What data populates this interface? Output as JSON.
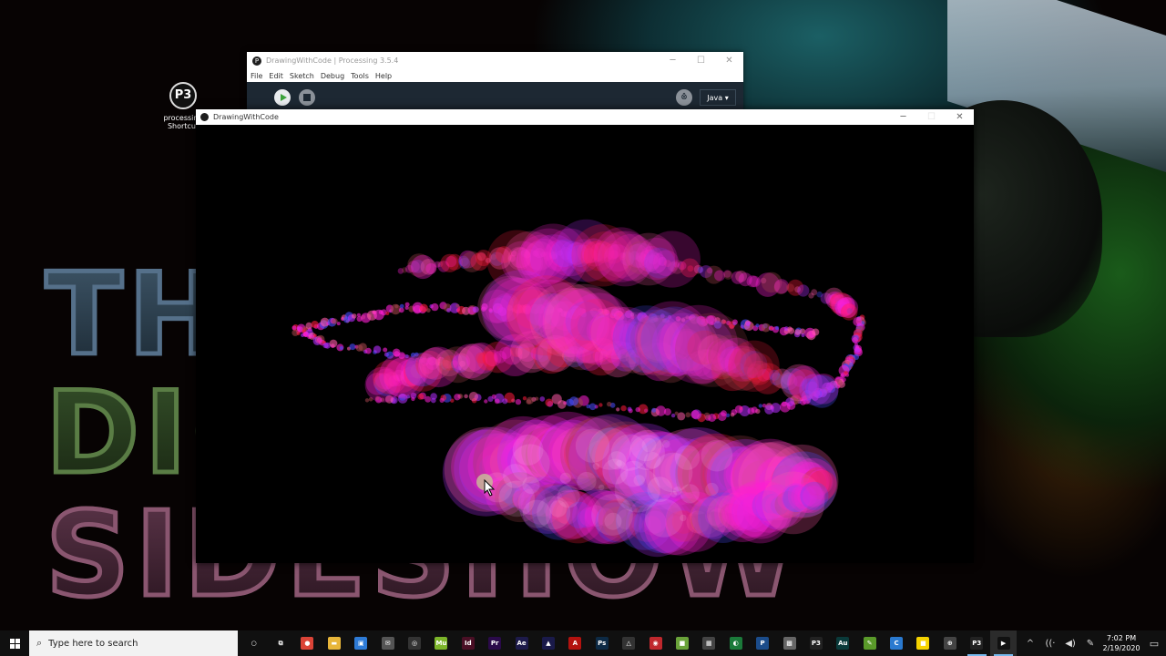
{
  "wallpaper": {
    "words": [
      "TH",
      "DIG",
      "SIDESHOW"
    ]
  },
  "desktop_icon": {
    "label_line1": "processing",
    "label_line2": "Shortcut",
    "icon": "processing-p3-icon"
  },
  "ide_window": {
    "title": "DrawingWithCode | Processing 3.5.4",
    "menu": [
      "File",
      "Edit",
      "Sketch",
      "Debug",
      "Tools",
      "Help"
    ],
    "run_icon": "play-icon",
    "stop_icon": "stop-icon",
    "debug_icon": "debugger-icon",
    "mode": "Java ▾"
  },
  "sketch_window": {
    "title": "DrawingWithCode",
    "colors": {
      "magenta": "#ff1fd6",
      "pink": "#ff5aa8",
      "blue": "#4a4cff",
      "violet": "#b52dff",
      "red": "#ff1a3c",
      "brown": "#a0424a",
      "cream": "#ffd0f0"
    }
  },
  "taskbar": {
    "search_placeholder": "Type here to search",
    "time": "7:02 PM",
    "date": "2/19/2020",
    "apps": [
      {
        "name": "cortana-icon",
        "glyph": "○",
        "color": "transparent"
      },
      {
        "name": "task-view-icon",
        "glyph": "⧉",
        "color": "transparent"
      },
      {
        "name": "chrome-icon",
        "glyph": "●",
        "color": "#db4437"
      },
      {
        "name": "file-explorer-icon",
        "glyph": "▬",
        "color": "#e8b63a"
      },
      {
        "name": "store-icon",
        "glyph": "▣",
        "color": "#2e7bd6"
      },
      {
        "name": "mail-icon",
        "glyph": "✉",
        "color": "#555"
      },
      {
        "name": "obs-icon",
        "glyph": "◎",
        "color": "#333"
      },
      {
        "name": "muse-icon",
        "glyph": "Mu",
        "color": "#7cb52a"
      },
      {
        "name": "indesign-icon",
        "glyph": "Id",
        "color": "#4a0f25"
      },
      {
        "name": "premiere-icon",
        "glyph": "Pr",
        "color": "#2a0a4a"
      },
      {
        "name": "after-effects-icon",
        "glyph": "Ae",
        "color": "#1d1a4a"
      },
      {
        "name": "media-encoder-icon",
        "glyph": "▲",
        "color": "#1a1a4a"
      },
      {
        "name": "acrobat-icon",
        "glyph": "A",
        "color": "#b3120f"
      },
      {
        "name": "photoshop-icon",
        "glyph": "Ps",
        "color": "#0d2a45"
      },
      {
        "name": "drive-icon",
        "glyph": "△",
        "color": "#333"
      },
      {
        "name": "redcircle-icon",
        "glyph": "◉",
        "color": "#c0282d"
      },
      {
        "name": "minecraft-icon",
        "glyph": "■",
        "color": "#6aa33a"
      },
      {
        "name": "calculator-icon",
        "glyph": "▦",
        "color": "#444"
      },
      {
        "name": "green-app-icon",
        "glyph": "◐",
        "color": "#1b7a3a"
      },
      {
        "name": "pycharm-icon",
        "glyph": "P",
        "color": "#1b4c8a"
      },
      {
        "name": "settings-app-icon",
        "glyph": "▩",
        "color": "#666"
      },
      {
        "name": "processing-icon",
        "glyph": "P3",
        "color": "#222"
      },
      {
        "name": "audition-icon",
        "glyph": "Au",
        "color": "#0a3a3a"
      },
      {
        "name": "notepad-icon",
        "glyph": "✎",
        "color": "#5a9a2a"
      },
      {
        "name": "ccleaner-icon",
        "glyph": "C",
        "color": "#2a7ad0"
      },
      {
        "name": "sticky-notes-icon",
        "glyph": "■",
        "color": "#f5d300"
      },
      {
        "name": "game-icon",
        "glyph": "⊕",
        "color": "#444"
      },
      {
        "name": "processing-running-icon",
        "glyph": "P3",
        "color": "#222"
      },
      {
        "name": "sketch-running-icon",
        "glyph": "▶",
        "color": "#111"
      }
    ],
    "tray": [
      "^",
      "((·",
      "◀)",
      "✎"
    ],
    "notification_icon": "▭"
  }
}
